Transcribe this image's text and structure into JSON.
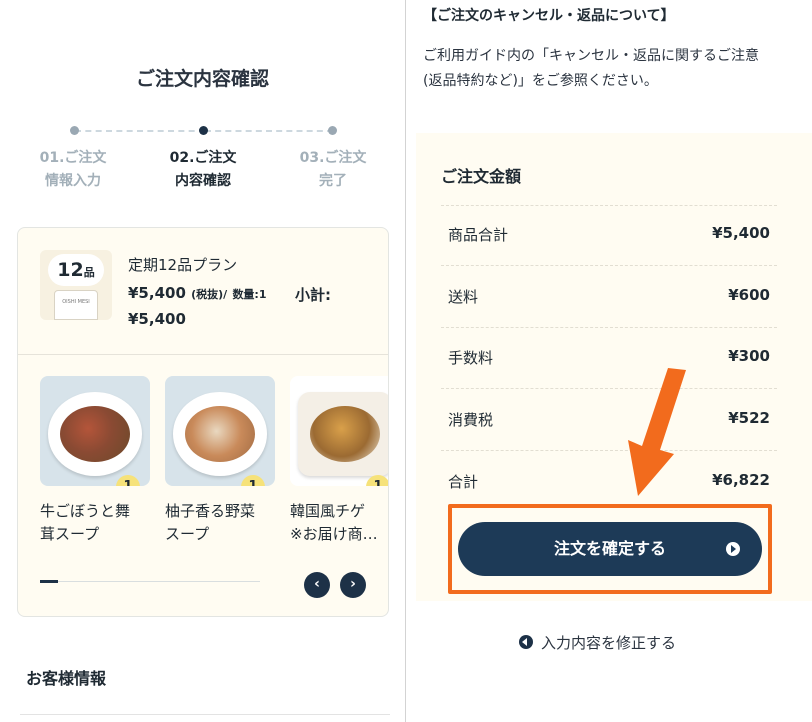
{
  "left": {
    "page_title": "ご注文内容確認",
    "steps": [
      {
        "line1": "01.ご注文",
        "line2": "情報入力",
        "state": "done"
      },
      {
        "line1": "02.ご注文",
        "line2": "内容確認",
        "state": "active"
      },
      {
        "line1": "03.ご注文",
        "line2": "完了",
        "state": "upcoming"
      }
    ],
    "plan": {
      "count": "12",
      "count_unit": "品",
      "bag_text": "OISHI MESI",
      "name": "定期12品プラン",
      "price": "¥5,400",
      "tax_note": "(税抜)/",
      "quantity": "数量:1",
      "subtotal_label": "小計:",
      "subtotal_value": "¥5,400"
    },
    "products": [
      {
        "name": "牛ごぼうと舞",
        "name2": "茸スープ",
        "qty": "1"
      },
      {
        "name": "柚子香る野菜",
        "name2": "スープ",
        "qty": "1"
      },
      {
        "name": "韓国風チゲ",
        "name2": "※お届け商…",
        "qty": "1"
      }
    ],
    "carousel_progress": 0.08,
    "prev_icon": "‹",
    "next_icon": "›",
    "customer_title": "お客様情報"
  },
  "right": {
    "cancel_heading": "【ご注文のキャンセル・返品について】",
    "cancel_line1": "ご利用ガイド内の「キャンセル・返品に関するご注意",
    "cancel_line2": "(返品特約など)」をご参照ください。",
    "summary_title": "ご注文金額",
    "rows": [
      {
        "label": "商品合計",
        "value": "¥5,400"
      },
      {
        "label": "送料",
        "value": "¥600"
      },
      {
        "label": "手数料",
        "value": "¥300"
      },
      {
        "label": "消費税",
        "value": "¥522"
      },
      {
        "label": "合計",
        "value": "¥6,822"
      }
    ],
    "confirm_label": "注文を確定する",
    "edit_label": "入力内容を修正する"
  },
  "colors": {
    "navy": "#1d3a57",
    "highlight": "#f26b1d",
    "cream": "#fffcf2",
    "badge": "#f6e27a"
  }
}
